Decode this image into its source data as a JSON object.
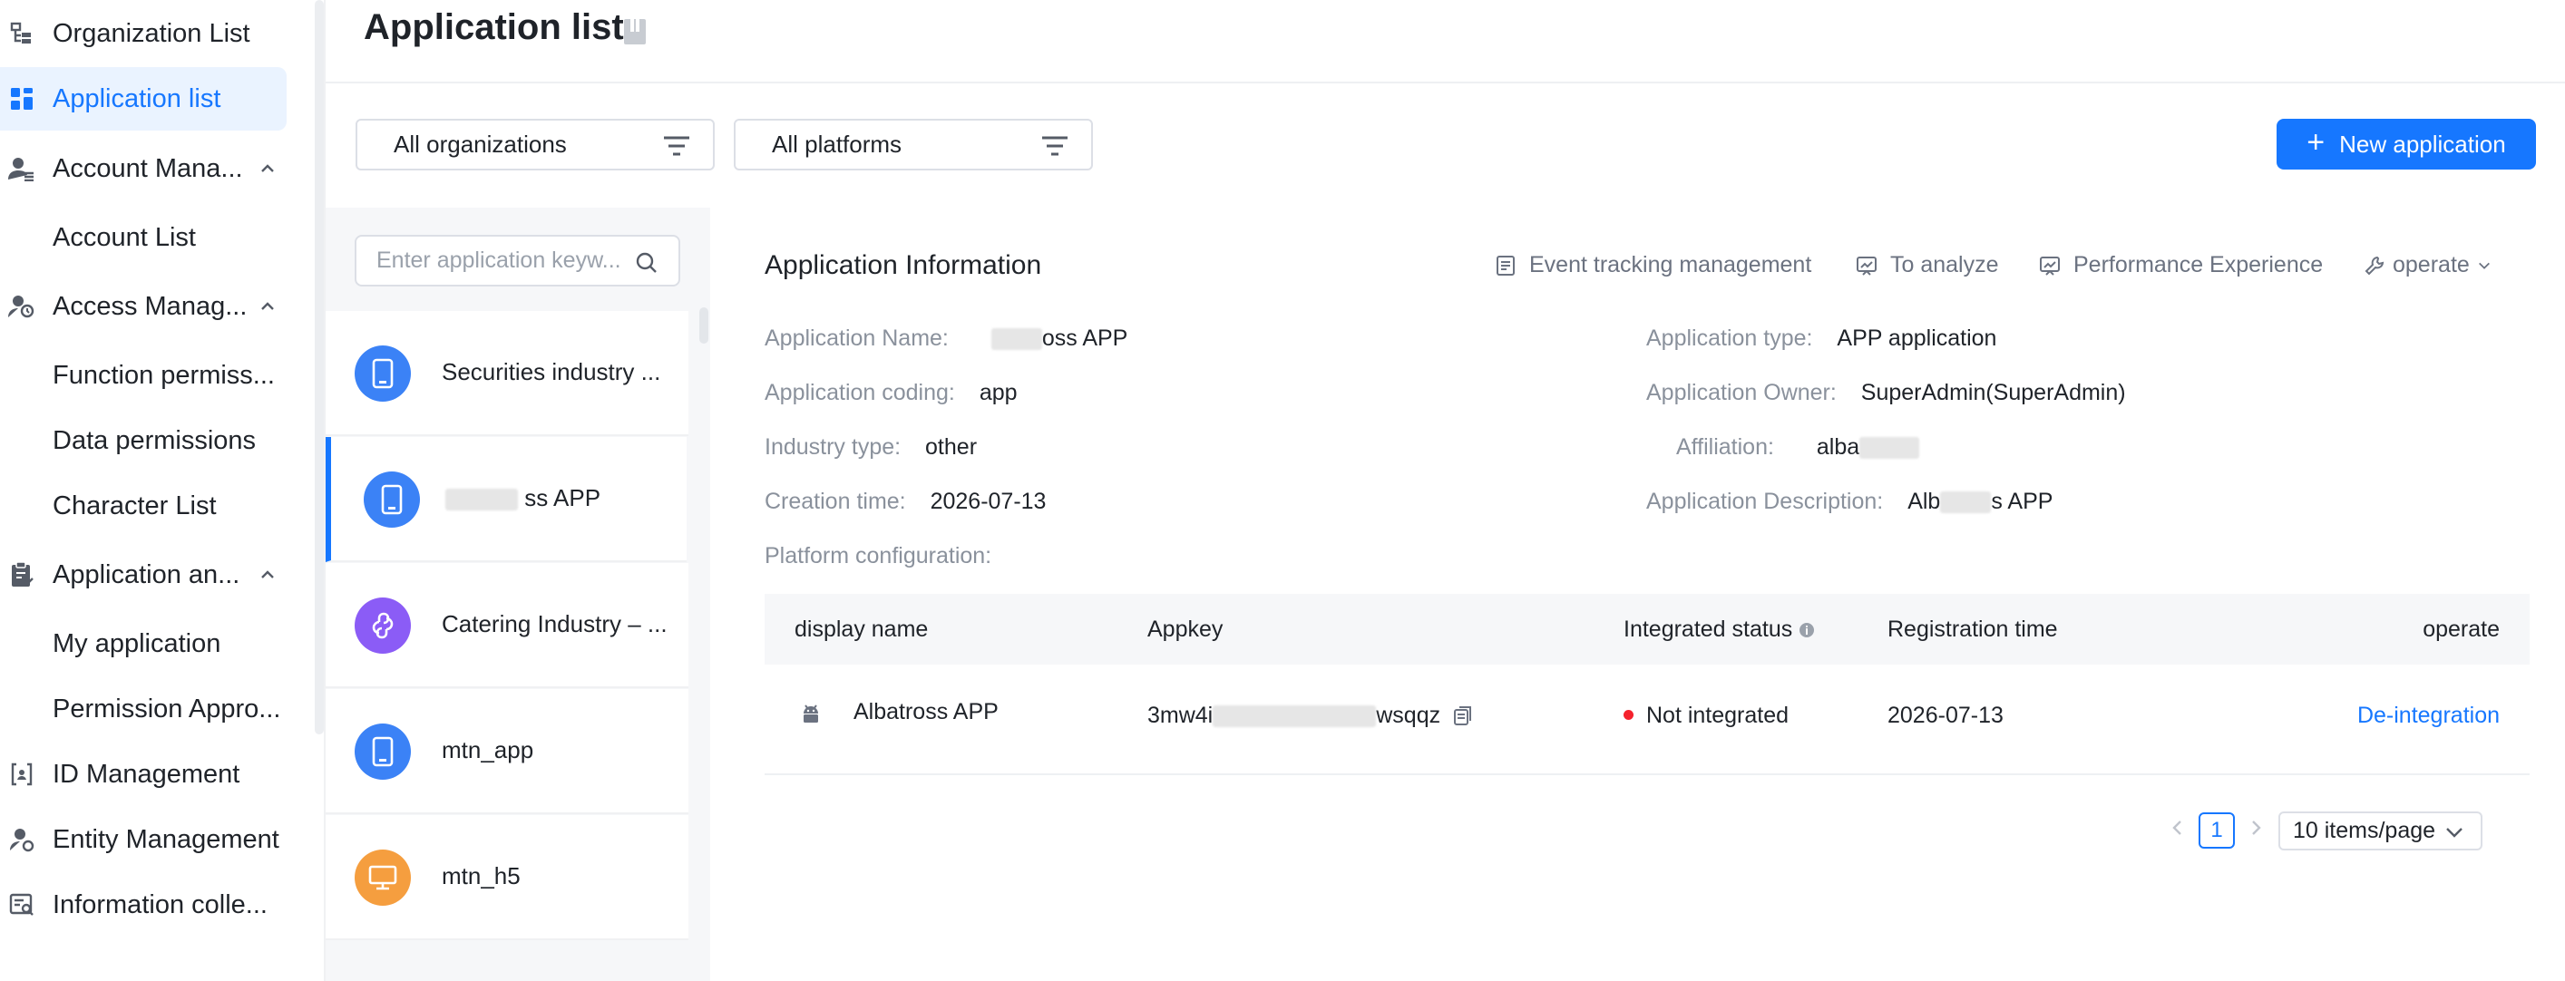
{
  "sidebar": {
    "items": [
      {
        "label": "Organization List",
        "icon": "org-tree-icon"
      },
      {
        "label": "Application list",
        "icon": "grid-icon",
        "active": true
      },
      {
        "label": "Account Mana...",
        "icon": "account-icon",
        "expanded": true
      },
      {
        "label": "Account List"
      },
      {
        "label": "Access Manag...",
        "icon": "access-icon",
        "expanded": true
      },
      {
        "label": "Function permiss..."
      },
      {
        "label": "Data permissions"
      },
      {
        "label": "Character List"
      },
      {
        "label": "Application an...",
        "icon": "clipboard-icon",
        "expanded": true
      },
      {
        "label": "My application"
      },
      {
        "label": "Permission Appro..."
      },
      {
        "label": "ID Management",
        "icon": "id-icon"
      },
      {
        "label": "Entity Management",
        "icon": "entity-icon"
      },
      {
        "label": "Information colle...",
        "icon": "info-collect-icon"
      }
    ]
  },
  "header": {
    "title": "Application list"
  },
  "filters": {
    "org": "All organizations",
    "platform": "All platforms"
  },
  "new_button": "New application",
  "app_list": {
    "search_placeholder": "Enter application keyw...",
    "apps": [
      {
        "name": "Securities industry ...",
        "type": "mobile",
        "color": "#3b82f6"
      },
      {
        "name": "ss APP",
        "type": "mobile",
        "color": "#3b82f6"
      },
      {
        "name": "Catering Industry – ...",
        "type": "miniprogram",
        "color": "#8b5cf6"
      },
      {
        "name": "mtn_app",
        "type": "mobile",
        "color": "#3b82f6"
      },
      {
        "name": "mtn_h5",
        "type": "web",
        "color": "#f59e3f"
      }
    ]
  },
  "detail": {
    "title": "Application Information",
    "actions": {
      "tracking": "Event tracking management",
      "analyze": "To analyze",
      "perf": "Performance Experience",
      "operate": "operate"
    },
    "fields": {
      "name_label": "Application Name:",
      "name_value": "oss APP",
      "coding_label": "Application coding:",
      "coding_value": "app",
      "industry_label": "Industry type:",
      "industry_value": "other",
      "creation_label": "Creation time:",
      "creation_value": "2026-07-13",
      "platform_label": "Platform configuration:",
      "type_label": "Application type:",
      "type_value": "APP application",
      "owner_label": "Application Owner:",
      "owner_value": "SuperAdmin(SuperAdmin)",
      "affiliation_label": "Affiliation:",
      "affiliation_value": "alba",
      "desc_label": "Application Description:",
      "desc_value_a": "Alb",
      "desc_value_b": "s APP"
    }
  },
  "table": {
    "headers": {
      "name": "display name",
      "appkey": "Appkey",
      "status": "Integrated status",
      "reg": "Registration time",
      "op": "operate"
    },
    "rows": [
      {
        "name": "Albatross APP",
        "appkey_a": "3mw4i",
        "appkey_b": "wsqqz",
        "status": "Not integrated",
        "reg": "2026-07-13",
        "op": "De-integration"
      }
    ]
  },
  "pagination": {
    "page": "1",
    "size": "10 items/page"
  }
}
